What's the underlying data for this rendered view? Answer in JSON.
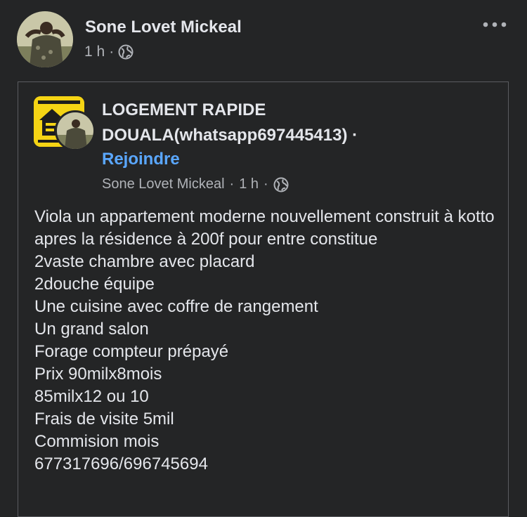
{
  "post": {
    "author": "Sone Lovet Mickeal",
    "time": "1 h",
    "separator": "·",
    "audience_icon": "globe-icon",
    "more_icon": "more-options-icon"
  },
  "shared": {
    "group_title": "LOGEMENT RAPIDE DOUALA(whatsapp697445413) ·",
    "join_label": "Rejoindre",
    "author": "Sone Lovet Mickeal",
    "time": "1 h",
    "separator": "·",
    "audience_icon": "globe-icon",
    "body_lines": [
      "Viola un appartement moderne nouvellement construit à kotto apres la résidence à 200f pour entre constitue",
      "2vaste chambre avec placard",
      "2douche équipe",
      "Une cuisine avec coffre de rangement",
      "Un grand salon",
      "Forage compteur prépayé",
      "Prix 90milx8mois",
      "85milx12 ou 10",
      "Frais de visite 5mil",
      "Commision mois",
      "677317696/696745694"
    ]
  },
  "colors": {
    "background": "#242526",
    "primary_text": "#e4e6eb",
    "secondary_text": "#b0b3b8",
    "link": "#5aa7ff",
    "group_logo": "#f5d414"
  }
}
